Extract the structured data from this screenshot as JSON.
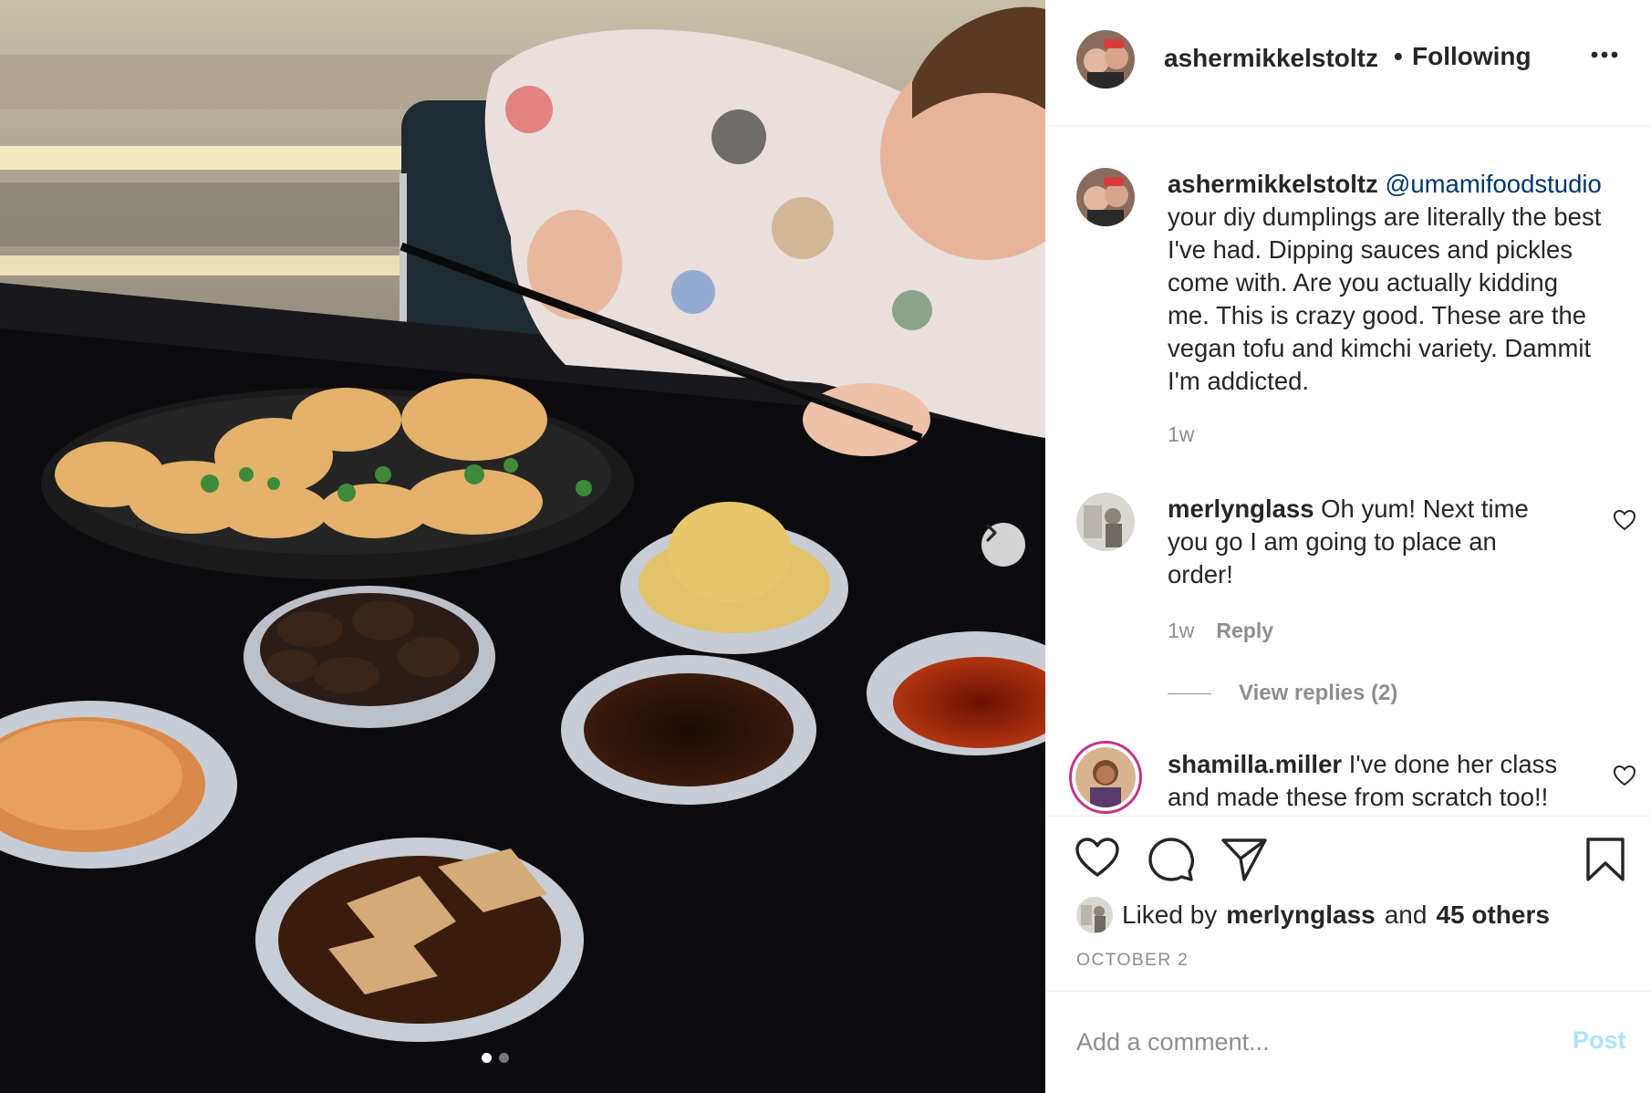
{
  "post": {
    "author": "ashermikkelstoltz",
    "separator": "•",
    "follow_status": "Following",
    "more_icon": "more-horizontal-icon",
    "carousel": {
      "next_icon": "chevron-right-icon",
      "slide_count": 2,
      "active_slide": 1
    }
  },
  "caption": {
    "username": "ashermikkelstoltz",
    "mention": "@umamifoodstudio",
    "text_lines": [
      "your diy dumplings are literally the best",
      "I've had. Dipping sauces and pickles",
      "come with. Are you actually kidding",
      "me. This is crazy good. These are the",
      "vegan tofu and kimchi variety. Dammit",
      "I'm addicted."
    ],
    "age": "1w"
  },
  "comments": [
    {
      "username": "merlynglass",
      "first_line": "Oh yum! Next time",
      "lines": [
        "you go I am going to place an",
        "order!"
      ],
      "age": "1w",
      "reply_label": "Reply",
      "view_replies": "View replies (2)"
    },
    {
      "username": "shamilla.miller",
      "first_line": "I've done her class",
      "lines": [
        "and made these from scratch too!!"
      ]
    }
  ],
  "actions": {
    "like_icon": "heart-icon",
    "comment_icon": "comment-icon",
    "share_icon": "paper-plane-icon",
    "save_icon": "bookmark-icon"
  },
  "likes": {
    "prefix": "Liked by",
    "user": "merlynglass",
    "middle": "and",
    "others": "45 others"
  },
  "date": "OCTOBER 2",
  "add_comment": {
    "placeholder": "Add a comment...",
    "post_label": "Post"
  },
  "colors": {
    "link": "#00376b",
    "muted": "#8e8e8e",
    "post_disabled": "#b2dffc",
    "text": "#262626"
  }
}
